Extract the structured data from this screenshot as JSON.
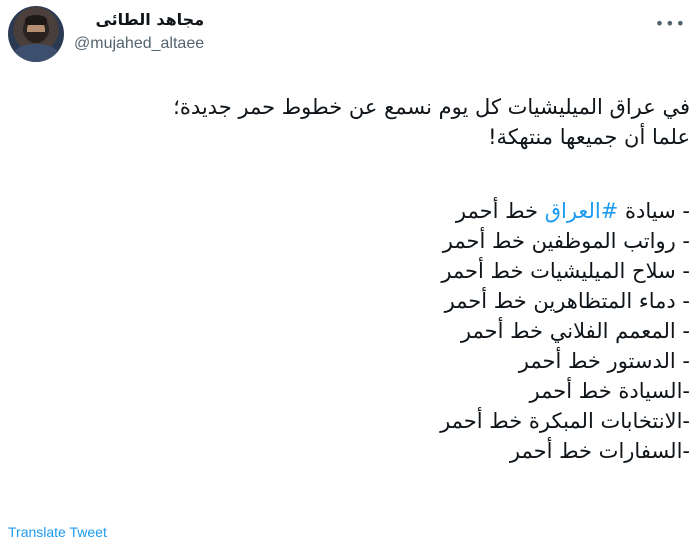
{
  "user": {
    "display_name": "مجاهد الطائى",
    "handle": "@mujahed_altaee"
  },
  "menu": {
    "more_glyph": "•••",
    "more_icon": "more-options-icon"
  },
  "tweet": {
    "intro": [
      "في عراق الميليشيات كل يوم نسمع عن خطوط حمر جديدة؛",
      "علما أن جميعها منتهكة!"
    ],
    "first_item": {
      "prefix": "- سيادة ",
      "hashtag": "#العراق",
      "suffix": " خط أحمر"
    },
    "items": [
      "- رواتب الموظفين خط أحمر",
      "- سلاح الميليشيات خط أحمر",
      "- دماء المتظاهرين خط أحمر",
      "- المعمم الفلاني خط أحمر",
      "- الدستور خط أحمر",
      "-السيادة خط أحمر",
      "-الانتخابات المبكرة خط أحمر",
      "-السفارات خط أحمر"
    ]
  },
  "actions": {
    "translate_label": "Translate Tweet"
  },
  "colors": {
    "link": "#1d9bf0",
    "text": "#0f1419",
    "secondary": "#536471"
  }
}
